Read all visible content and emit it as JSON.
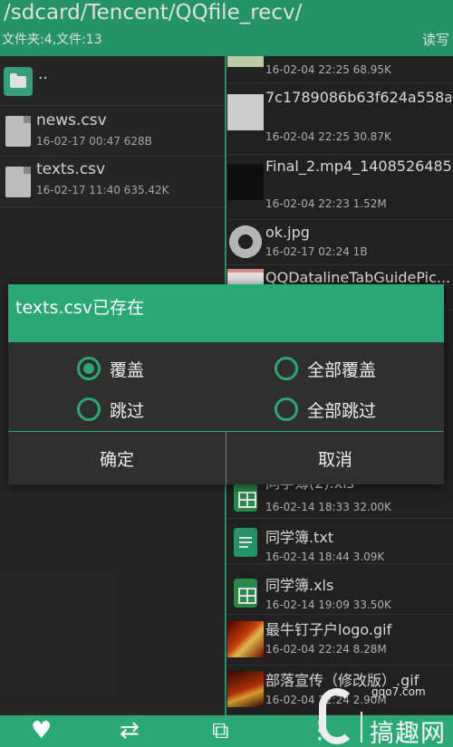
{
  "header": {
    "path": "/sdcard/Tencent/QQfile_recv/",
    "count": "文件夹:4,文件:13",
    "rw": "读写"
  },
  "left_pane": {
    "parent": "..",
    "files": [
      {
        "name": "news.csv",
        "meta": "16-02-17 00:47  628B"
      },
      {
        "name": "texts.csv",
        "meta": "16-02-17 11:40  635.42K"
      }
    ]
  },
  "right_pane": {
    "files": [
      {
        "name": "",
        "meta": "16-02-04 22:25  68.95K"
      },
      {
        "name": "7c1789086b63f624a558a3e58144ebf81b4ca3d...",
        "meta": "16-02-04 22:25  30.87K"
      },
      {
        "name": "Final_2.mp4_1408526485.gif",
        "meta": "16-02-04 22:23  1.52M"
      },
      {
        "name": "ok.jpg",
        "meta": "16-02-17 02:24  1B"
      },
      {
        "name": "QQDatalineTabGuidePic..."
      },
      {
        "name": "同学簿(2).xls",
        "meta": "16-02-14 18:33  32.00K"
      },
      {
        "name": "同学簿.txt",
        "meta": "16-02-14 18:44  3.09K"
      },
      {
        "name": "同学簿.xls",
        "meta": "16-02-14 19:09  33.50K"
      },
      {
        "name": "最牛钉子户logo.gif",
        "meta": "16-02-04 22:24  8.28M"
      },
      {
        "name": "部落宣传（修改版）.gif",
        "meta": "16-02-04 22:24  2.90M"
      }
    ]
  },
  "dialog": {
    "title": "texts.csv已存在",
    "options": [
      {
        "label": "覆盖",
        "selected": true
      },
      {
        "label": "全部覆盖",
        "selected": false
      },
      {
        "label": "跳过",
        "selected": false
      },
      {
        "label": "全部跳过",
        "selected": false
      }
    ],
    "confirm": "确定",
    "cancel": "取消"
  },
  "toolbar": {
    "icons": [
      "heart-icon",
      "swap-icon",
      "copy-add-icon",
      "more-icon"
    ],
    "glyphs": {
      "heart": "♥",
      "swap": "⇄",
      "copy": "⧉",
      "more": "⋮"
    }
  },
  "watermark": {
    "site": "gqo7.com",
    "text": "搞趣网"
  },
  "colors": {
    "accent": "#2aa876",
    "background": "#2b2b2b"
  }
}
